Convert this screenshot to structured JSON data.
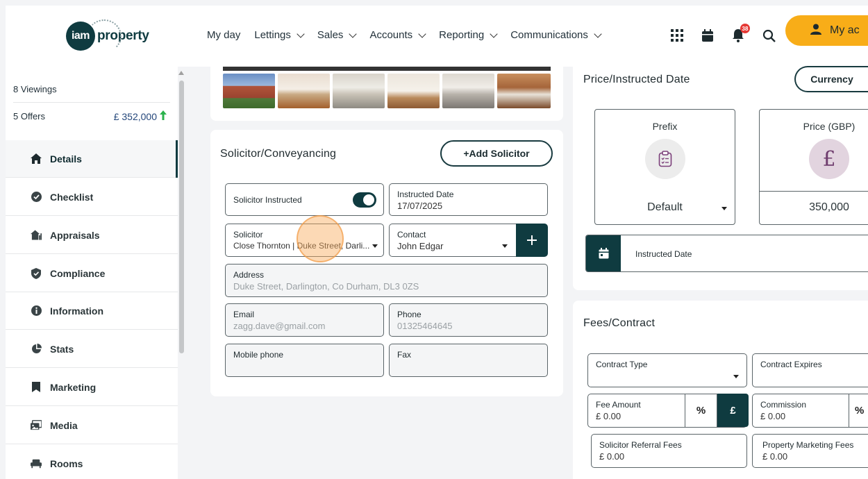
{
  "brand": {
    "logo_mark": "iam",
    "logo_word": "property"
  },
  "nav": {
    "items": [
      {
        "label": "My day",
        "dropdown": false
      },
      {
        "label": "Lettings",
        "dropdown": true
      },
      {
        "label": "Sales",
        "dropdown": true
      },
      {
        "label": "Accounts",
        "dropdown": true
      },
      {
        "label": "Reporting",
        "dropdown": true
      },
      {
        "label": "Communications",
        "dropdown": true
      }
    ],
    "notification_count": "38",
    "account_label": "My ac"
  },
  "sidebar": {
    "viewings": "8 Viewings",
    "offers": "5 Offers",
    "offers_value": "£ 352,000",
    "items": [
      {
        "label": "Details",
        "icon": "home-icon",
        "active": true
      },
      {
        "label": "Checklist",
        "icon": "check-circle-icon",
        "active": false
      },
      {
        "label": "Appraisals",
        "icon": "house-chart-icon",
        "active": false
      },
      {
        "label": "Compliance",
        "icon": "shield-icon",
        "active": false
      },
      {
        "label": "Information",
        "icon": "info-icon",
        "active": false
      },
      {
        "label": "Stats",
        "icon": "pie-chart-icon",
        "active": false
      },
      {
        "label": "Marketing",
        "icon": "bookmark-icon",
        "active": false
      },
      {
        "label": "Media",
        "icon": "media-icon",
        "active": false
      },
      {
        "label": "Rooms",
        "icon": "sofa-icon",
        "active": false
      }
    ]
  },
  "solicitor": {
    "title": "Solicitor/Conveyancing",
    "add_button": "+Add Solicitor",
    "instructed_label": "Solicitor Instructed",
    "instructed_on": true,
    "instructed_date_label": "Instructed Date",
    "instructed_date_value": "17/07/2025",
    "solicitor_label": "Solicitor",
    "solicitor_value": "Close Thornton | Duke Street, Darli...",
    "contact_label": "Contact",
    "contact_value": "John Edgar",
    "address_label": "Address",
    "address_value": "Duke Street, Darlington, Co Durham, DL3 0ZS",
    "email_label": "Email",
    "email_value": "zagg.dave@gmail.com",
    "phone_label": "Phone",
    "phone_value": "01325464645",
    "mobile_label": "Mobile phone",
    "fax_label": "Fax"
  },
  "price": {
    "title": "Price/Instructed Date",
    "currency_button": "Currency",
    "prefix_label": "Prefix",
    "prefix_value": "Default",
    "price_label": "Price (GBP)",
    "price_symbol": "£",
    "price_value": "350,000",
    "instructed_date_label": "Instructed Date"
  },
  "fees": {
    "title": "Fees/Contract",
    "contract_type_label": "Contract Type",
    "contract_expires_label": "Contract Expires",
    "fee_amount_label": "Fee Amount",
    "fee_amount_value": "£ 0.00",
    "percent_symbol": "%",
    "pound_symbol": "£",
    "commission_label": "Commission",
    "commission_value": "£ 0.00",
    "commission_symbol": "%",
    "referral_label": "Solicitor Referral Fees",
    "referral_value": "£ 0.00",
    "marketing_label": "Property Marketing Fees",
    "marketing_value": "£ 0.00"
  },
  "colors": {
    "brand_dark": "#0f3b40",
    "accent": "#f8ad18",
    "offer_up": "#2bb24c",
    "alert": "#e53935"
  }
}
